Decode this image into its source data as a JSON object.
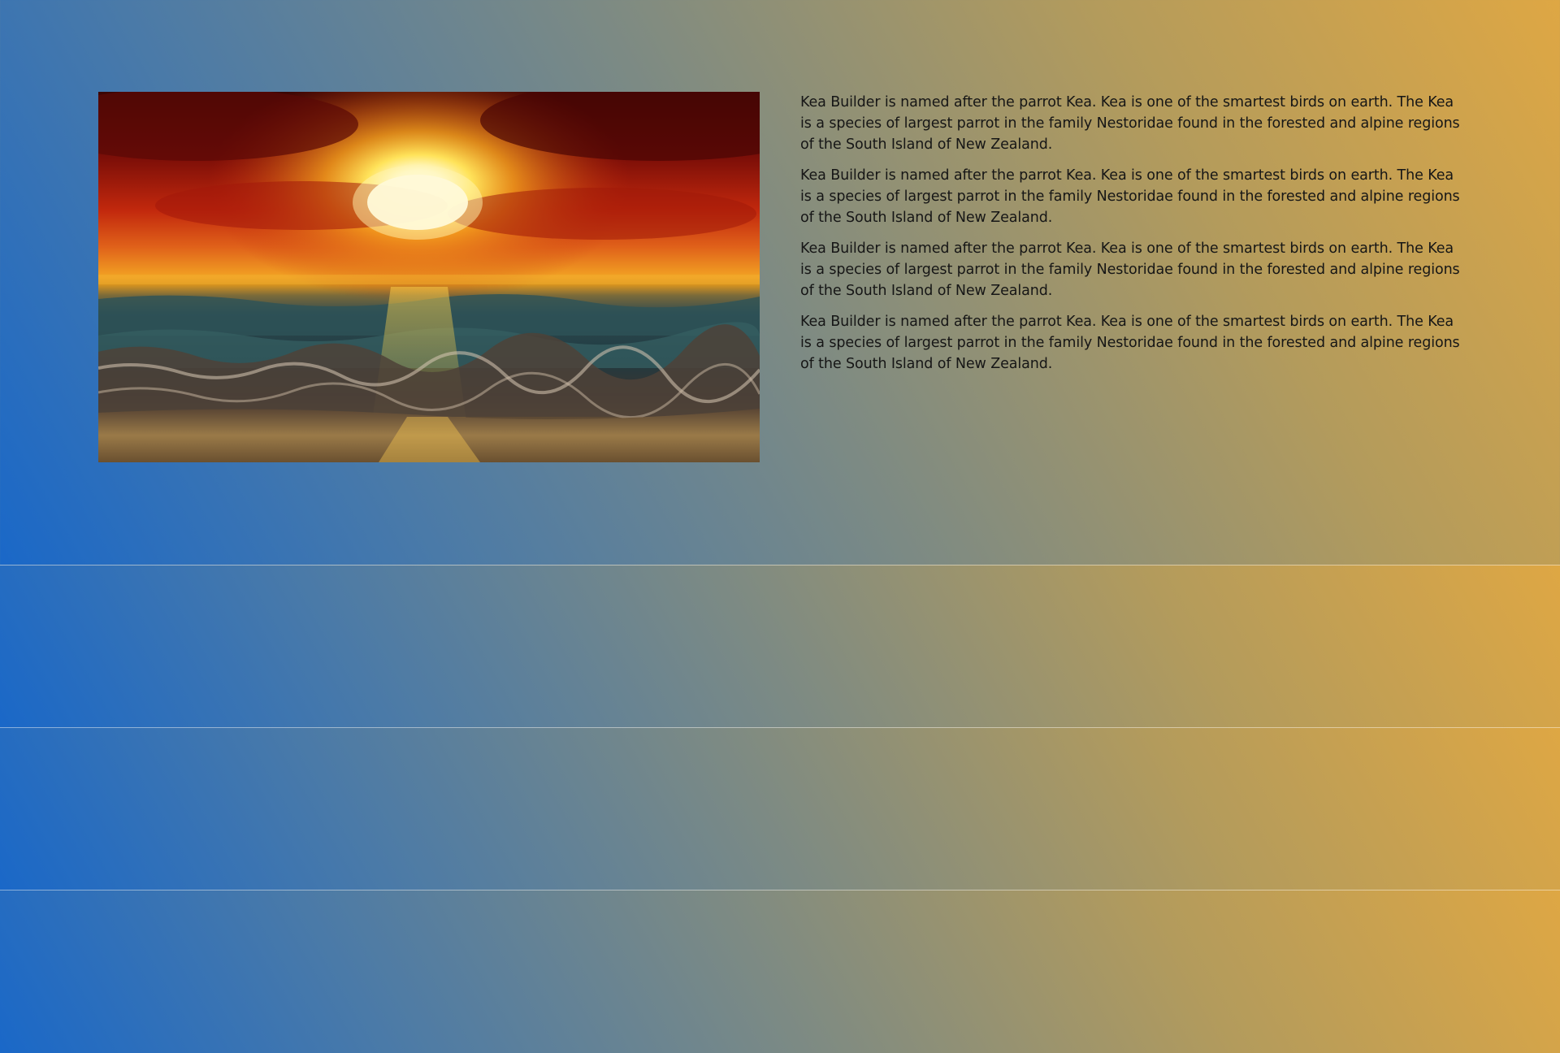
{
  "hero": {
    "image": {
      "icon": "sunset-ocean-image"
    },
    "paragraphs": [
      "Kea Builder is named after the parrot Kea. Kea is one of the smartest birds on earth. The Kea is a species of largest parrot in the family Nestoridae found in the forested and alpine regions of the South Island of New Zealand.",
      "Kea Builder is named after the parrot Kea. Kea is one of the smartest birds on earth. The Kea is a species of largest parrot in the family Nestoridae found in the forested and alpine regions of the South Island of New Zealand.",
      "Kea Builder is named after the parrot Kea. Kea is one of the smartest birds on earth. The Kea is a species of largest parrot in the family Nestoridae found in the forested and alpine regions of the South Island of New Zealand.",
      "Kea Builder is named after the parrot Kea. Kea is one of the smartest birds on earth. The Kea is a species of largest parrot in the family Nestoridae found in the forested and alpine regions of the South Island of New Zealand."
    ]
  },
  "colors": {
    "gradient_start": "#1a68c8",
    "gradient_end": "#dea744",
    "divider": "#ffffff"
  }
}
